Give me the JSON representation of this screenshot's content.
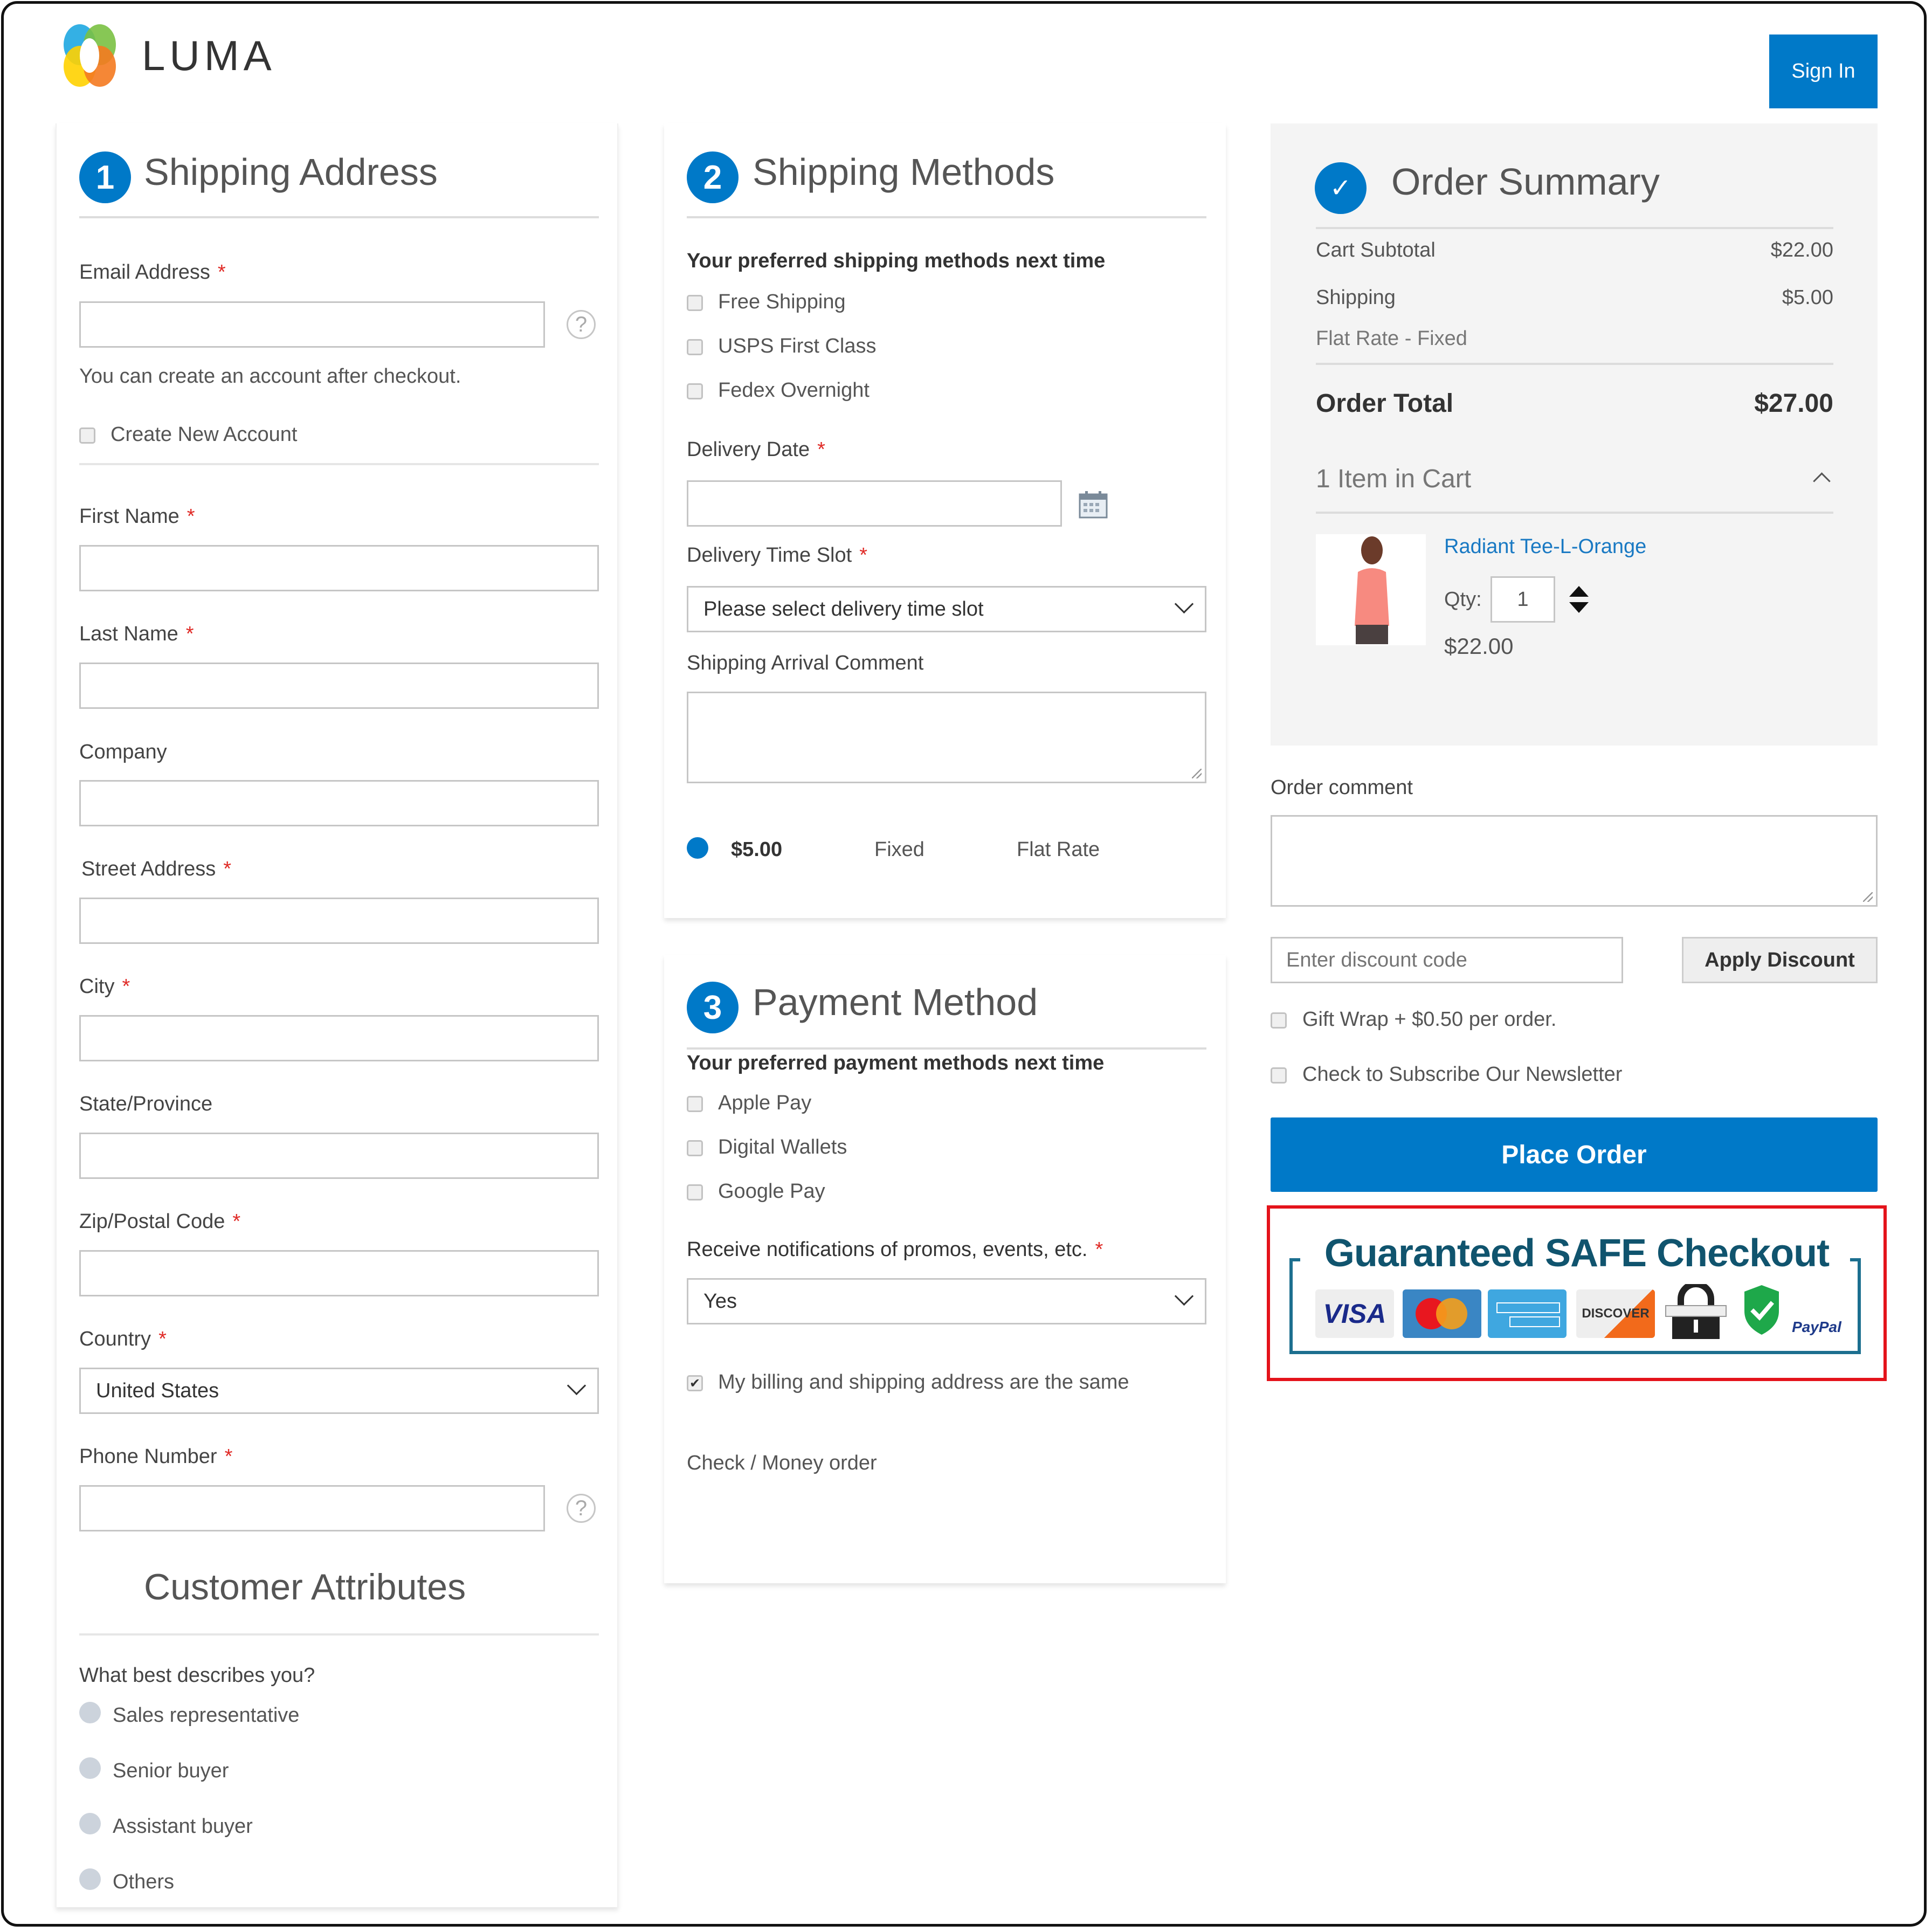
{
  "header": {
    "brand": "LUMA",
    "sign_in_label": "Sign In"
  },
  "colors": {
    "accent": "#0079c8",
    "required": "#e02b27",
    "link": "#1979c3",
    "highlight_box": "#e4131b",
    "summary_bg": "#f4f4f4"
  },
  "shipping_address": {
    "step": "1",
    "title": "Shipping Address",
    "email_label": "Email Address",
    "email_value": "",
    "email_note": "You can create an account after checkout.",
    "create_account_label": "Create New Account",
    "create_account_checked": false,
    "first_name_label": "First Name",
    "last_name_label": "Last Name",
    "company_label": "Company",
    "street_label": "Street Address",
    "city_label": "City",
    "state_label": "State/Province",
    "zip_label": "Zip/Postal Code",
    "country_label": "Country",
    "country_value": "United States",
    "phone_label": "Phone Number",
    "required_mark": "*",
    "help_glyph": "?"
  },
  "customer_attributes": {
    "title": "Customer Attributes",
    "question": "What best describes you?",
    "options": [
      "Sales representative",
      "Senior buyer",
      "Assistant buyer",
      "Others"
    ]
  },
  "shipping_methods": {
    "step": "2",
    "title": "Shipping Methods",
    "preferred_heading": "Your preferred shipping methods next time",
    "preferred_options": [
      "Free Shipping",
      "USPS First Class",
      "Fedex Overnight"
    ],
    "delivery_date_label": "Delivery Date",
    "delivery_slot_label": "Delivery Time Slot",
    "delivery_slot_value": "Please select delivery time slot",
    "arrival_comment_label": "Shipping Arrival Comment",
    "rate": {
      "price": "$5.00",
      "method": "Fixed",
      "carrier": "Flat Rate",
      "selected": true
    }
  },
  "payment_method": {
    "step": "3",
    "title": "Payment Method",
    "preferred_heading": "Your preferred payment methods next time",
    "preferred_options": [
      "Apple Pay",
      "Digital Wallets",
      "Google Pay"
    ],
    "notifications_label": "Receive notifications of promos, events, etc.",
    "notifications_value": "Yes",
    "billing_same_label": "My billing and shipping address are the same",
    "billing_same_checked": true,
    "method_name": "Check / Money order"
  },
  "order_summary": {
    "title": "Order Summary",
    "check_glyph": "✓",
    "rows": [
      {
        "label": "Cart Subtotal",
        "value": "$22.00"
      },
      {
        "label": "Shipping",
        "value": "$5.00"
      }
    ],
    "shipping_detail": "Flat Rate - Fixed",
    "total_label": "Order Total",
    "total_value": "$27.00",
    "items_in_cart": "1 Item in Cart",
    "item": {
      "name": "Radiant Tee-L-Orange",
      "qty_label": "Qty:",
      "qty": "1",
      "price": "$22.00"
    }
  },
  "extras": {
    "order_comment_label": "Order comment",
    "discount_placeholder": "Enter discount code",
    "apply_discount_label": "Apply Discount",
    "gift_wrap_label": "Gift Wrap + $0.50 per order.",
    "newsletter_label": "Check to Subscribe Our Newsletter",
    "place_order_label": "Place Order"
  },
  "trust_badge": {
    "title": "Guaranteed SAFE Checkout",
    "cards": [
      "VISA",
      "MasterCard",
      "American Express",
      "DISCOVER",
      "Secure Lock",
      "Shield Verified",
      "PayPal"
    ]
  }
}
